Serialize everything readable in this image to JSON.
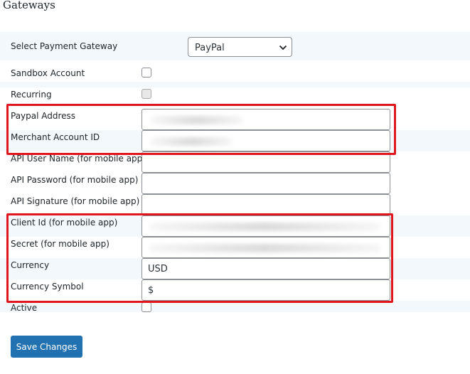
{
  "page": {
    "title": "Gateways"
  },
  "gateway": {
    "label": "Select Payment Gateway",
    "selected": "PayPal"
  },
  "fields": {
    "sandbox": {
      "label": "Sandbox Account"
    },
    "recurring": {
      "label": "Recurring"
    },
    "paypal_address": {
      "label": "Paypal Address",
      "value": ""
    },
    "merchant_id": {
      "label": "Merchant Account ID",
      "value": ""
    },
    "api_user": {
      "label": "API User Name (for mobile app)",
      "value": ""
    },
    "api_password": {
      "label": "API Password (for mobile app)",
      "value": ""
    },
    "api_signature": {
      "label": "API Signature (for mobile app)",
      "value": ""
    },
    "client_id": {
      "label": "Client Id (for mobile app)",
      "value": ""
    },
    "secret": {
      "label": "Secret (for mobile app)",
      "value": ""
    },
    "currency": {
      "label": "Currency",
      "value": "USD"
    },
    "currency_symbol": {
      "label": "Currency Symbol",
      "value": "$"
    },
    "active": {
      "label": "Active"
    }
  },
  "actions": {
    "save_label": "Save Changes"
  },
  "colors": {
    "highlight": "#e0161e",
    "primary_button": "#2271b1",
    "row_band": "#f3f8fd"
  }
}
